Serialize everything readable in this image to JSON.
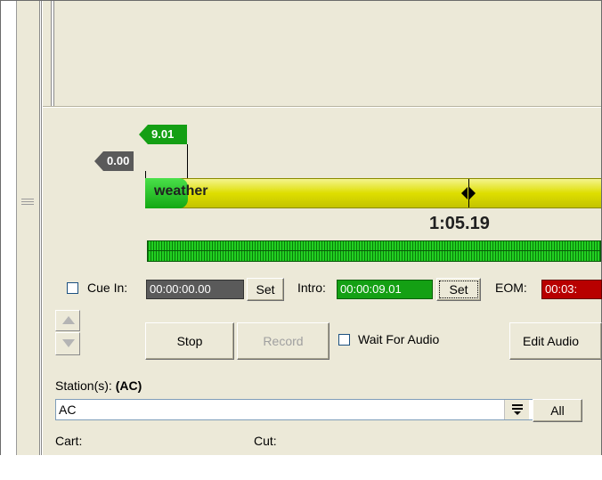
{
  "timeline": {
    "intro_flag": "9.01",
    "start_flag": "0.00",
    "segment_label": "weather",
    "playhead_time": "1:05.19"
  },
  "cue_in": {
    "checkbox_label": "Cue In:",
    "value": "00:00:00.00",
    "set_label": "Set"
  },
  "intro": {
    "label": "Intro:",
    "value": "00:00:09.01",
    "set_label": "Set"
  },
  "eom": {
    "label": "EOM:",
    "value": "00:03:"
  },
  "controls": {
    "stop_label": "Stop",
    "record_label": "Record",
    "wait_for_audio_label": "Wait For Audio",
    "edit_audio_label": "Edit Audio"
  },
  "stations": {
    "label": "Station(s):",
    "current": "(AC)",
    "selected_value": "AC",
    "all_label": "All"
  },
  "fields": {
    "cart_label": "Cart:",
    "cut_label": "Cut:"
  },
  "colors": {
    "panel_bg": "#ece9d8",
    "waveform_yellow": "#dede00",
    "marker_green": "#149f14",
    "marker_grey": "#5a5a5a",
    "eom_red": "#b80000"
  }
}
